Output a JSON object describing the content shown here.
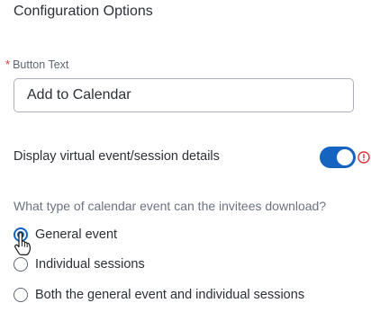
{
  "section": {
    "title": "Configuration Options"
  },
  "button_text_field": {
    "required_marker": "*",
    "label": "Button Text",
    "value": "Add to Calendar"
  },
  "virtual_details": {
    "label": "Display virtual event/session details",
    "toggle_on": true,
    "accent_color": "#1565c0",
    "alert_icon": "exclamation-circle-icon",
    "alert_color": "#d9363e"
  },
  "calendar_type": {
    "question": "What type of calendar event can the invitees download?",
    "options": [
      {
        "label": "General event",
        "checked": true
      },
      {
        "label": "Individual sessions",
        "checked": false
      },
      {
        "label": "Both the general event and individual sessions",
        "checked": false
      }
    ]
  },
  "cursor": {
    "icon": "hand-pointer-icon"
  }
}
